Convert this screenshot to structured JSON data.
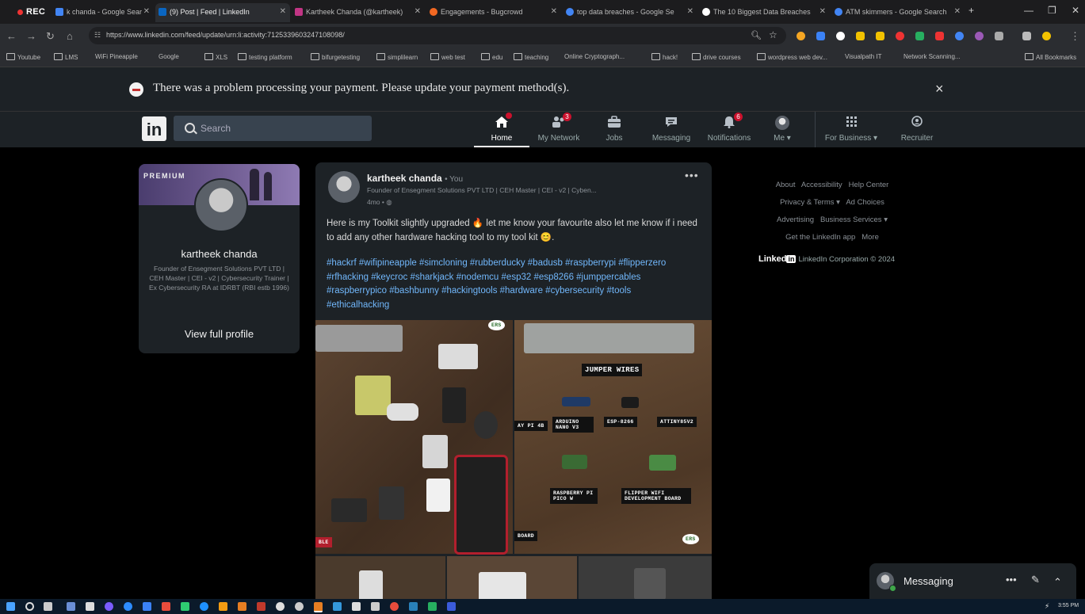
{
  "browser": {
    "rec_label": "REC",
    "tabs": [
      {
        "title": "k chanda - Google Sear",
        "color": "#4285f4"
      },
      {
        "title": "(9) Post | Feed | LinkedIn",
        "color": "#0a66c2"
      },
      {
        "title": "Kartheek Chanda (@kartheek)",
        "color": "#c13584"
      },
      {
        "title": "Engagements - Bugcrowd",
        "color": "#f26822"
      },
      {
        "title": "top data breaches - Google Se",
        "color": "#4285f4"
      },
      {
        "title": "The 10 Biggest Data Breaches",
        "color": "#fff"
      },
      {
        "title": "ATM skimmers - Google Search",
        "color": "#4285f4"
      }
    ],
    "new_tab": "+",
    "url": "https://www.linkedin.com/feed/update/urn:li:activity:7125339603247108098/",
    "bookmarks": [
      "Youtube",
      "LMS",
      "WiFi Pineapple",
      "Google",
      "XLS",
      "testing platform",
      "bifurgetesting",
      "simplilearn",
      "web test",
      "edu",
      "teaching",
      "Online Cryptograph...",
      "hack!",
      "drive courses",
      "wordpress web dev...",
      "Visualpath IT",
      "Network Scanning...",
      "All Bookmarks"
    ]
  },
  "banner": {
    "message": "There was a problem processing your payment. Please update your payment method(s).",
    "close": "×"
  },
  "nav": {
    "logo": "in",
    "search_placeholder": "Search",
    "items": [
      {
        "label": "Home",
        "badge": ""
      },
      {
        "label": "My Network",
        "badge": "3"
      },
      {
        "label": "Jobs",
        "badge": ""
      },
      {
        "label": "Messaging",
        "badge": ""
      },
      {
        "label": "Notifications",
        "badge": "6"
      },
      {
        "label": "Me ▾",
        "badge": ""
      },
      {
        "label": "For Business ▾",
        "badge": ""
      },
      {
        "label": "Recruiter",
        "badge": ""
      }
    ]
  },
  "profile": {
    "premium": "PREMIUM",
    "name": "kartheek chanda",
    "headline": "Founder of Ensegment Solutions PVT LTD | CEH Master | CEI - v2 | Cybersecurity Trainer | Ex Cybersecurity RA at IDRBT (RBI estb 1996)",
    "view_profile": "View full profile"
  },
  "post": {
    "author": "kartheek chanda",
    "you": "• You",
    "subtitle": "Founder of Ensegment Solutions PVT LTD | CEH Master | CEI - v2 | Cyben...",
    "time": "4mo • ◍",
    "more": "•••",
    "text": "Here is my Toolkit slightly upgraded 🔥 let me know your favourite also let me know if i need to add any other hardware hacking tool to my tool kit 😊.",
    "hashtags": "#hackrf #wifipineapple #simcloning #rubberducky #badusb #raspberrypi #flipperzero #rfhacking #keycroc #sharkjack #nodemcu #esp32 #esp8266 #jumppercables #raspberrypico #bashbunny #hackingtools #hardware #cybersecurity #tools #ethicalhacking",
    "image_labels": {
      "jumper": "JUMPER WIRES",
      "rpi": "AY PI 4B",
      "arduino": "ARDUINO NANO V3",
      "esp": "ESP-8266",
      "attiny": "ATTINY85V2",
      "pico": "RASPBERRY PI PICO W",
      "flipper": "FLIPPER WIFI DEVELOPMENT BOARD",
      "board": "BOARD",
      "bls": "BLE",
      "logo": "ERS"
    }
  },
  "footer": {
    "links_row1": [
      "About",
      "Accessibility",
      "Help Center"
    ],
    "links_row2": [
      "Privacy & Terms ▾",
      "Ad Choices"
    ],
    "links_row3": [
      "Advertising",
      "Business Services ▾"
    ],
    "links_row4": [
      "Get the LinkedIn app",
      "More"
    ],
    "brand": "Linked",
    "brand_in": "in",
    "copyright": "LinkedIn Corporation © 2024"
  },
  "messaging": {
    "label": "Messaging",
    "more": "•••",
    "compose": "✎",
    "collapse": "⌃"
  },
  "taskbar": {
    "time": "3:55 PM"
  }
}
